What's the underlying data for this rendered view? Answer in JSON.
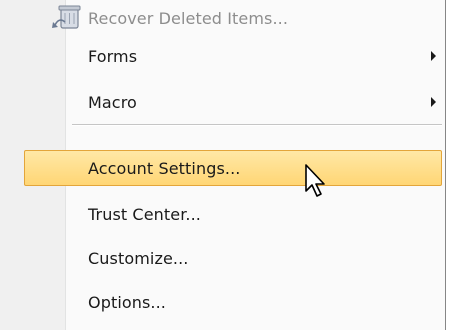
{
  "menu": {
    "items": [
      {
        "label": "Recover Deleted Items...",
        "enabled": false,
        "has_submenu": false
      },
      {
        "label": "Forms",
        "enabled": true,
        "has_submenu": true
      },
      {
        "label": "Macro",
        "enabled": true,
        "has_submenu": true
      },
      {
        "label": "Account Settings...",
        "enabled": true,
        "has_submenu": false,
        "highlighted": true
      },
      {
        "label": "Trust Center...",
        "enabled": true,
        "has_submenu": false
      },
      {
        "label": "Customize...",
        "enabled": true,
        "has_submenu": false
      },
      {
        "label": "Options...",
        "enabled": true,
        "has_submenu": false
      }
    ]
  },
  "icons": {
    "recover_deleted_items": "recycle-bin-recover-icon",
    "submenu_arrow": "chevron-right-icon",
    "cursor": "mouse-pointer-icon"
  },
  "colors": {
    "highlight_fill_top": "#ffe8a6",
    "highlight_fill_bottom": "#ffd675",
    "highlight_border": "#e3a53a",
    "disabled_text": "#8d8d8d"
  }
}
